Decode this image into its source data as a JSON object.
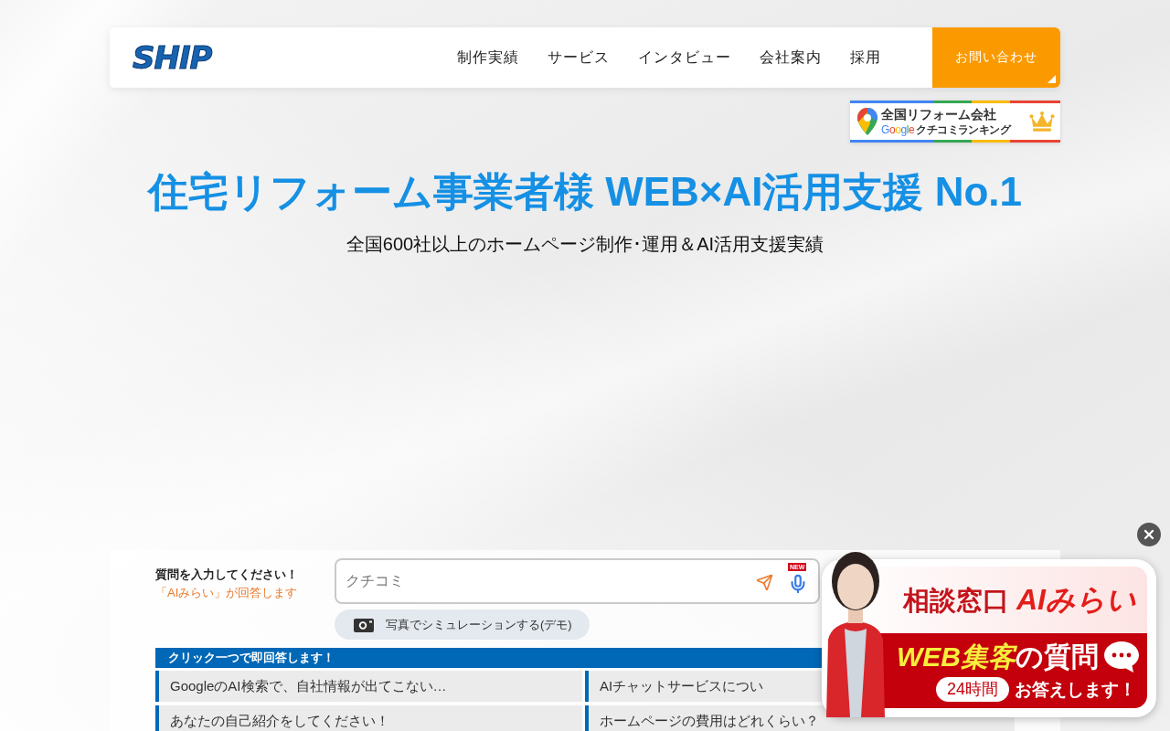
{
  "header": {
    "logo": "SHIP",
    "nav": [
      "制作実績",
      "サービス",
      "インタビュー",
      "会社案内",
      "採用"
    ],
    "contact_button": "お問い合わせ"
  },
  "ranking_badge": {
    "title": "全国リフォーム会社",
    "brand": "Google",
    "subtitle": "クチコミランキング"
  },
  "hero": {
    "headline": "住宅リフォーム事業者様 WEB×AI活用支援 No.1",
    "subheadline": "全国600社以上のホームページ制作･運用＆AI活用支援実績"
  },
  "chat": {
    "prompt": "質問を入力してください！",
    "note": "「AIみらい」が回答します",
    "input": {
      "value": "クチコミ"
    },
    "voice_badge": "NEW",
    "photo_button": "写真でシミュレーションする(デモ)",
    "quick_header": "クリック一つで即回答します！",
    "quick_questions": [
      "GoogleのAI検索で、自社情報が出てこない…",
      "AIチャットサービスについ",
      "あなたの自己紹介をしてください！",
      "ホームページの費用はどれくらい？"
    ]
  },
  "banner": {
    "title": "相談窓口 *AIみらい*",
    "headline_highlight": "WEB集客",
    "headline_rest": "の質問",
    "hours": "24時間",
    "tagline": "お答えします！"
  }
}
